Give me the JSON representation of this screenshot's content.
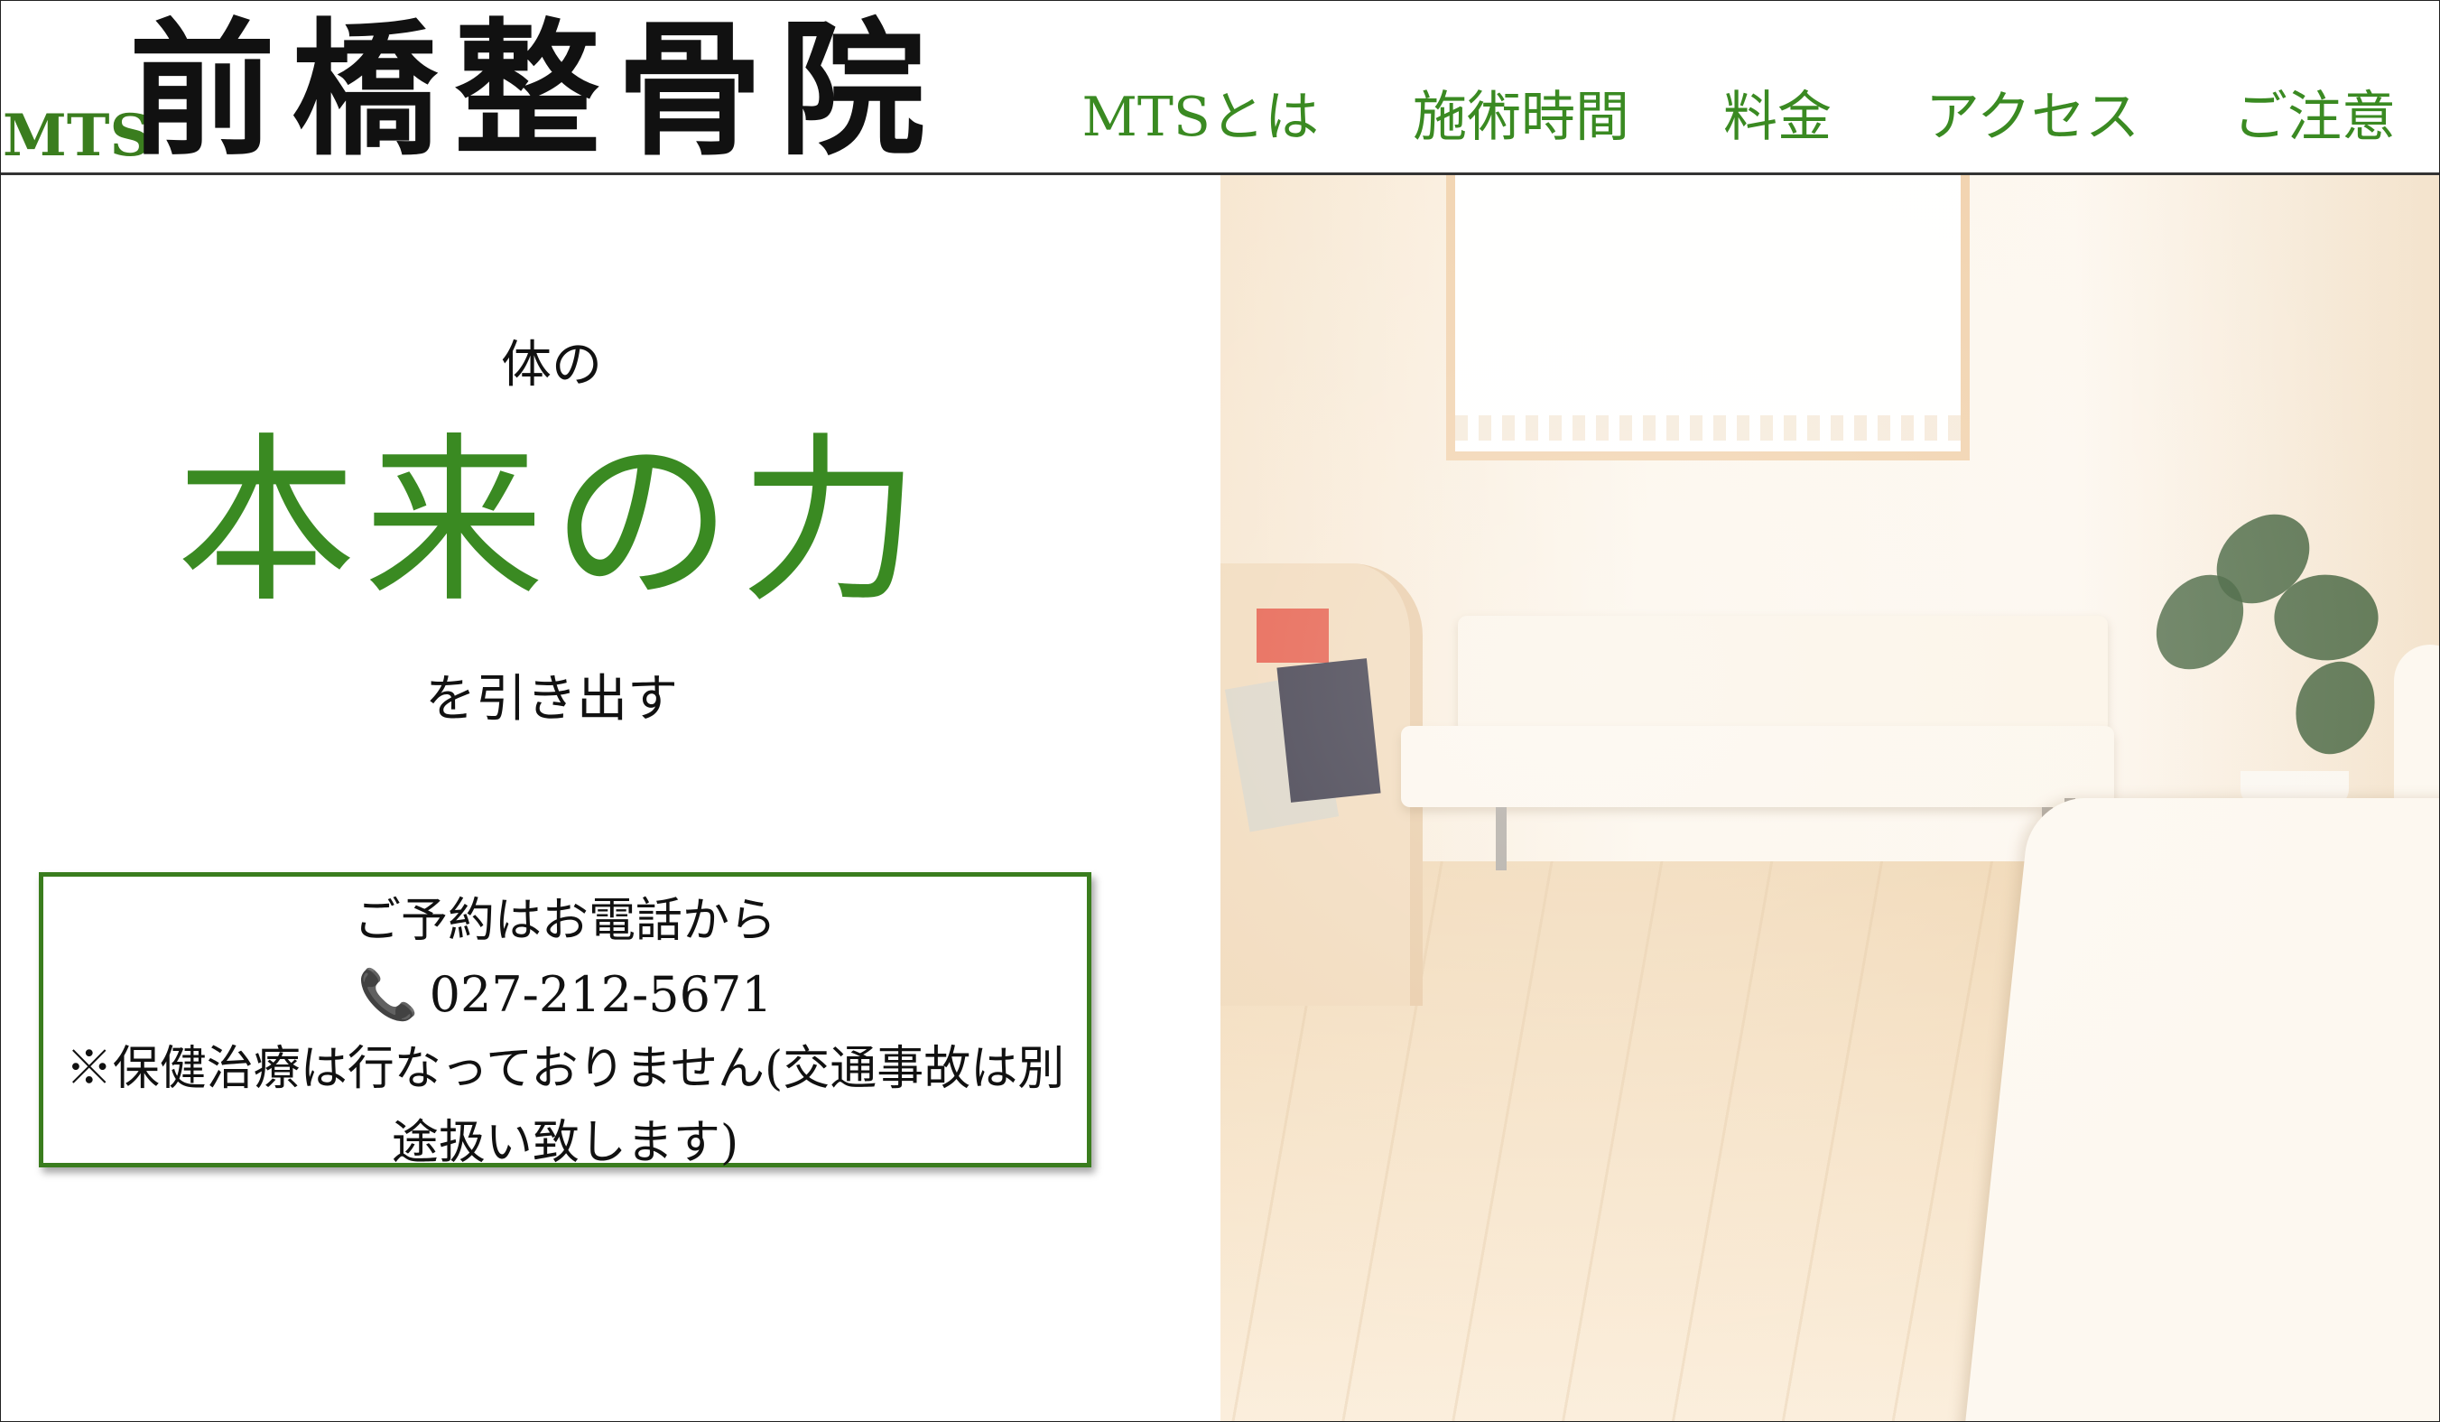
{
  "header": {
    "logo_prefix": "MTS",
    "logo_main": "前橋整骨院",
    "nav": [
      {
        "label": "MTSとは"
      },
      {
        "label": "施術時間"
      },
      {
        "label": "料金"
      },
      {
        "label": "アクセス"
      },
      {
        "label": "ご注意"
      }
    ],
    "accent_color": "#3a8a22"
  },
  "hero": {
    "lead_top": "体の",
    "lead_main": "本来の力",
    "lead_bottom": "を引き出す"
  },
  "reservation": {
    "heading": "ご予約はお電話から",
    "phone_icon": "phone-icon",
    "phone_glyph": "📞",
    "phone": "027-212-5671",
    "note": "※保健治療は行なっておりません(交通事故は別途扱い致します)",
    "border_color": "#3a7d1e"
  },
  "photo": {
    "icon": "waiting-room-photo"
  }
}
